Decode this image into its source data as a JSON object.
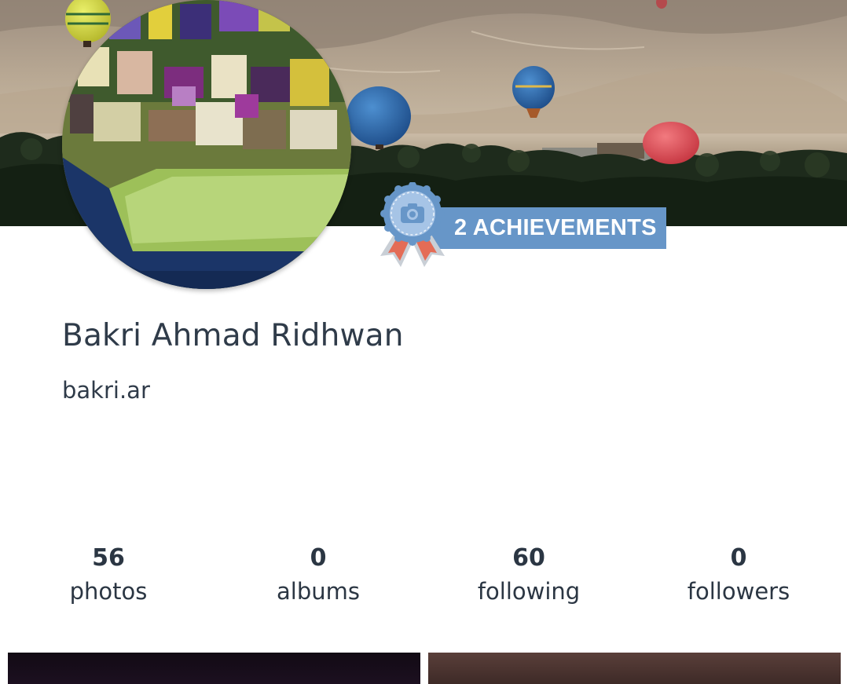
{
  "profile": {
    "name": "Bakri Ahmad Ridhwan",
    "username": "bakri.ar"
  },
  "achievements": {
    "label": "2 ACHIEVEMENTS",
    "count": 2,
    "icon": "award-ribbon-camera-icon",
    "color": "#6796c8"
  },
  "stats": [
    {
      "value": "56",
      "label": "photos"
    },
    {
      "value": "0",
      "label": "albums"
    },
    {
      "value": "60",
      "label": "following"
    },
    {
      "value": "0",
      "label": "followers"
    }
  ],
  "colors": {
    "text": "#2b3643",
    "accent": "#6796c8",
    "background": "#ffffff"
  }
}
